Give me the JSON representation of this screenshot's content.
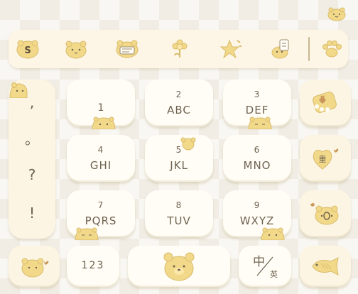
{
  "toolbar": {
    "icons": [
      "swype-s-icon",
      "bear-face-icon",
      "bear-keyboard-icon",
      "flower-icon",
      "star-icon",
      "clipboard-bear-icon",
      "paw-icon"
    ]
  },
  "punctuation": [
    ",",
    "。",
    "?",
    "!"
  ],
  "keys": [
    {
      "num": "1",
      "letters": ""
    },
    {
      "num": "2",
      "letters": "ABC"
    },
    {
      "num": "3",
      "letters": "DEF"
    },
    {
      "num": "4",
      "letters": "GHI"
    },
    {
      "num": "5",
      "letters": "JKL"
    },
    {
      "num": "6",
      "letters": "MNO"
    },
    {
      "num": "7",
      "letters": "PQRS"
    },
    {
      "num": "8",
      "letters": "TUV"
    },
    {
      "num": "9",
      "letters": "WXYZ"
    }
  ],
  "bottom": {
    "numbers_label": "123",
    "lang_zh": "中",
    "lang_en": "英"
  },
  "colors": {
    "accent": "#f2d98a",
    "key_text": "#6f6250",
    "key_bg": "#fffdf6"
  }
}
